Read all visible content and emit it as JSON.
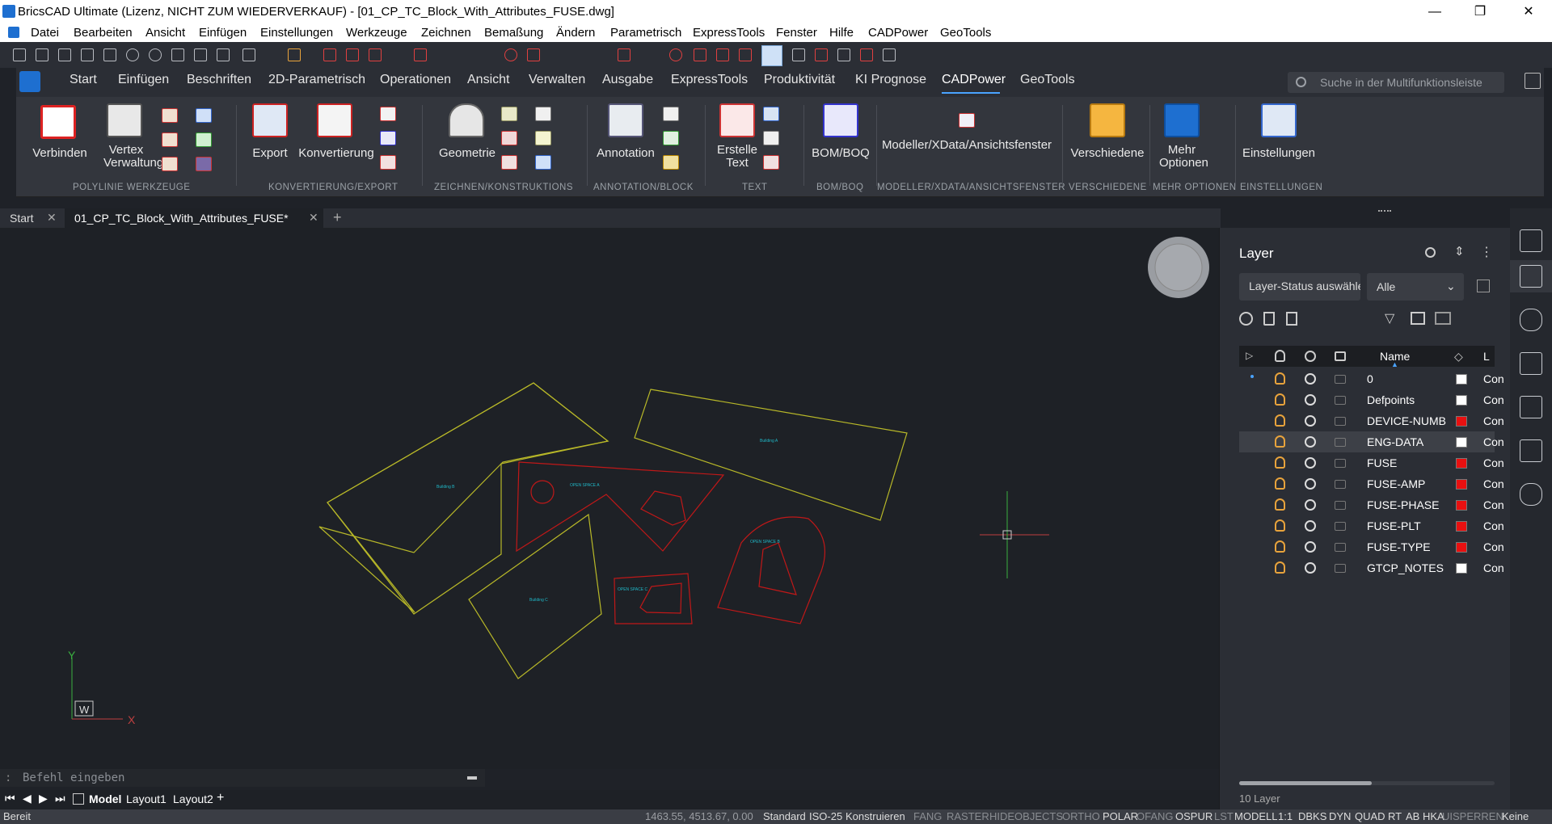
{
  "app": {
    "title": "BricsCAD Ultimate (Lizenz, NICHT ZUM WIEDERVERKAUF) - [01_CP_TC_Block_With_Attributes_FUSE.dwg]",
    "minimize": "—",
    "maximize": "❐",
    "close": "✕"
  },
  "menu": [
    "Datei",
    "Bearbeiten",
    "Ansicht",
    "Einfügen",
    "Einstellungen",
    "Werkzeuge",
    "Zeichnen",
    "Bemaßung",
    "Ändern",
    "Parametrisch",
    "ExpressTools",
    "Fenster",
    "Hilfe",
    "CADPower",
    "GeoTools"
  ],
  "ribbon_tabs": [
    "Start",
    "Einfügen",
    "Beschriften",
    "2D-Parametrisch",
    "Operationen",
    "Ansicht",
    "Verwalten",
    "Ausgabe",
    "ExpressTools",
    "Produktivität",
    "KI Prognose",
    "CADPower",
    "GeoTools"
  ],
  "active_tab": "CADPower",
  "search_placeholder": "Suche in der Multifunktionsleiste",
  "ribbon": {
    "buttons": [
      "Verbinden",
      "Vertex Verwaltung",
      "Export",
      "Konvertierung",
      "Geometrie",
      "Annotation",
      "Erstelle Text",
      "BOM/BOQ",
      "Modeller/XData/Ansichtsfenster",
      "Verschiedene",
      "Mehr Optionen",
      "Einstellungen"
    ],
    "groups": [
      "POLYLINIE WERKZEUGE",
      "KONVERTIERUNG/EXPORT",
      "ZEICHNEN/KONSTRUKTIONS",
      "ANNOTATION/BLOCK",
      "TEXT",
      "BOM/BOQ",
      "MODELLER/XDATA/ANSICHTSFENSTER",
      "VERSCHIEDENE",
      "MEHR OPTIONEN",
      "EINSTELLUNGEN"
    ]
  },
  "doc_tabs": [
    "Start",
    "01_CP_TC_Block_With_Attributes_FUSE*"
  ],
  "drawing_labels": [
    "Building B",
    "Building A",
    "OPEN SPACE A",
    "OPEN SPACE B",
    "Building C",
    "OPEN SPACE C"
  ],
  "ucs": {
    "y": "Y",
    "x": "X",
    "w": "W"
  },
  "command_placeholder": "Befehl eingeben",
  "layout_tabs": [
    "Model",
    "Layout1",
    "Layout2"
  ],
  "status": {
    "left": "Bereit",
    "coords": "1463.55, 4513.67, 0.00",
    "items": [
      "Standard",
      "ISO-25",
      "Konstruieren",
      "FANG",
      "RASTER",
      "HIDEOBJECTS",
      "ORTHO",
      "POLAR",
      "OFANG",
      "OSPUR",
      "LST",
      "MODELL",
      "1:1",
      "DBKS",
      "DYN",
      "QUAD",
      "RT",
      "AB",
      "HKA",
      "UISPERREN",
      "Keine"
    ]
  },
  "layer_panel": {
    "title": "Layer",
    "state_placeholder": "Layer-Status auswähle",
    "filter": "Alle",
    "col_name": "Name",
    "col_lt": "L",
    "count": "10 Layer",
    "layers": [
      {
        "name": "0",
        "color": "#ffffff",
        "lt": "Con"
      },
      {
        "name": "Defpoints",
        "color": "#ffffff",
        "lt": "Con"
      },
      {
        "name": "DEVICE-NUMB",
        "color": "#e81010",
        "lt": "Con"
      },
      {
        "name": "ENG-DATA",
        "color": "#ffffff",
        "lt": "Con"
      },
      {
        "name": "FUSE",
        "color": "#e81010",
        "lt": "Con"
      },
      {
        "name": "FUSE-AMP",
        "color": "#e81010",
        "lt": "Con"
      },
      {
        "name": "FUSE-PHASE",
        "color": "#e81010",
        "lt": "Con"
      },
      {
        "name": "FUSE-PLT",
        "color": "#e81010",
        "lt": "Con"
      },
      {
        "name": "FUSE-TYPE",
        "color": "#e81010",
        "lt": "Con"
      },
      {
        "name": "GTCP_NOTES",
        "color": "#ffffff",
        "lt": "Con"
      }
    ],
    "selected_layer": "ENG-DATA"
  },
  "colors": {
    "yellow": "#b8b828",
    "red": "#c01818",
    "cyan": "#20b8c8",
    "accent": "#4aa3ff"
  }
}
